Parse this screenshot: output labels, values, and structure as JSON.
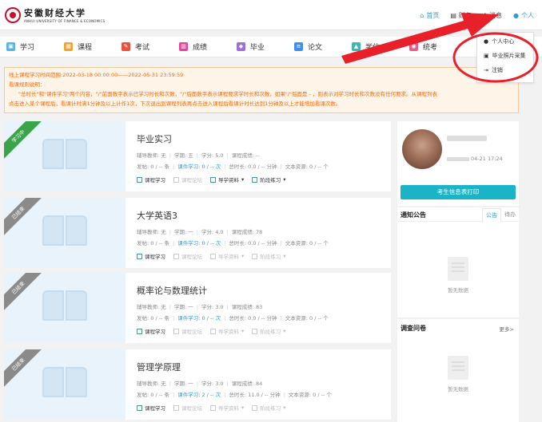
{
  "header": {
    "logo_cn": "安徽财经大学",
    "logo_en": "ANHUI UNIVERSITY OF FINANCE & ECONOMICS",
    "topnav": [
      {
        "label": "首页",
        "icon": "home-icon",
        "active": true
      },
      {
        "label": "财务",
        "icon": "wallet-icon"
      },
      {
        "label": "消息",
        "icon": "bell-icon"
      },
      {
        "label": "个人",
        "icon": "user-icon"
      }
    ]
  },
  "mainnav": [
    {
      "label": "学习",
      "icon": "study-icon",
      "color": "#55b4e0"
    },
    {
      "label": "课程",
      "icon": "course-icon",
      "color": "#f2a230"
    },
    {
      "label": "考试",
      "icon": "exam-icon",
      "color": "#e8533e"
    },
    {
      "label": "成绩",
      "icon": "grade-icon",
      "color": "#e0469a"
    },
    {
      "label": "毕业",
      "icon": "graduation-icon",
      "color": "#9a6fd8"
    },
    {
      "label": "论文",
      "icon": "thesis-icon",
      "color": "#3f8ee8"
    },
    {
      "label": "学位",
      "icon": "degree-icon",
      "color": "#3fb7b0"
    },
    {
      "label": "统考",
      "icon": "unified-exam-icon",
      "color": "#e05f8e"
    }
  ],
  "notice": {
    "line1": "线上课程学习时间范围:2022-03-18 00:00:00——2022-05-31 23:59:59",
    "line2": "看课规则说明：",
    "line3": "\"总时长\"和\"课件学习\"两个内容，\"/\"前面数字表示已学习时长和次数，\"/\"后面数字表示课程要求学时长和次数，如果\"/\"后面是 - ，则表示对学习时长和次数没有任何要求。从课程列表",
    "line4": "点击进入某个课程后，看课计时满1分钟及以上计作1次，下次退出到课程列表再点击进入课程后看课计时长达到1分钟及以上才能增加看课次数。"
  },
  "courses": [
    {
      "status": "学习中",
      "status_color": "green",
      "title": "毕业实习",
      "tutor": "辅导教师: 无",
      "term": "学期: 五",
      "credit": "学分: 5.0",
      "score": "课程成绩: --",
      "posts": "发帖: 0 / -- 条",
      "ware": "课件学习: 0 / -- 次",
      "time": "总时长: 0.0 / -- 分钟",
      "docs": "文本资源: 0 / -- 个",
      "act1": "课程学习",
      "act2": "课程论坛",
      "act3": "导学资料",
      "act4": "阶段练习"
    },
    {
      "status": "已结束",
      "status_color": "gray",
      "title": "大学英语3",
      "tutor": "辅导教师: 无",
      "term": "学期: 一",
      "credit": "学分: 4.0",
      "score": "课程成绩: 78",
      "posts": "发帖: 0 / -- 条",
      "ware": "课件学习: 0 / -- 次",
      "time": "总时长: 0.0 / -- 分钟",
      "docs": "文本资源: 0 / -- 个",
      "act1": "课程学习",
      "act2": "课程论坛",
      "act3": "导学资料",
      "act4": "阶段练习"
    },
    {
      "status": "已结束",
      "status_color": "gray",
      "title": "概率论与数理统计",
      "tutor": "辅导教师: 无",
      "term": "学期: 一",
      "credit": "学分: 3.0",
      "score": "课程成绩: 83",
      "posts": "发帖: 0 / -- 条",
      "ware": "课件学习: 0 / -- 次",
      "time": "总时长: 0.0 / -- 分钟",
      "docs": "文本资源: 0 / -- 个",
      "act1": "课程学习",
      "act2": "课程论坛",
      "act3": "导学资料",
      "act4": "阶段练习"
    },
    {
      "status": "已结束",
      "status_color": "gray",
      "title": "管理学原理",
      "tutor": "辅导教师: 无",
      "term": "学期: 一",
      "credit": "学分: 3.0",
      "score": "课程成绩: 84",
      "posts": "发帖: 0 / -- 条",
      "ware": "课件学习: 2 / -- 次",
      "time": "总时长: 11.0 / -- 分钟",
      "docs": "文本资源: 0 / -- 个",
      "act1": "课程学习",
      "act2": "课程论坛",
      "act3": "导学资料",
      "act4": "阶段练习"
    }
  ],
  "profile": {
    "login_time": "04-21 17:24",
    "print_button": "考生信息表打印"
  },
  "notices_panel": {
    "title": "通知公告",
    "tab_active": "公告",
    "tab_other": "待办",
    "empty": "暂无数据"
  },
  "survey_panel": {
    "title": "调查问卷",
    "more": "更多>",
    "empty": "暂无数据"
  },
  "dropdown": [
    {
      "label": "个人中心",
      "icon": "user-icon"
    },
    {
      "label": "毕业照片采集",
      "icon": "image-icon"
    },
    {
      "label": "注销",
      "icon": "logout-icon"
    }
  ],
  "annotation_color": "#e8202a"
}
